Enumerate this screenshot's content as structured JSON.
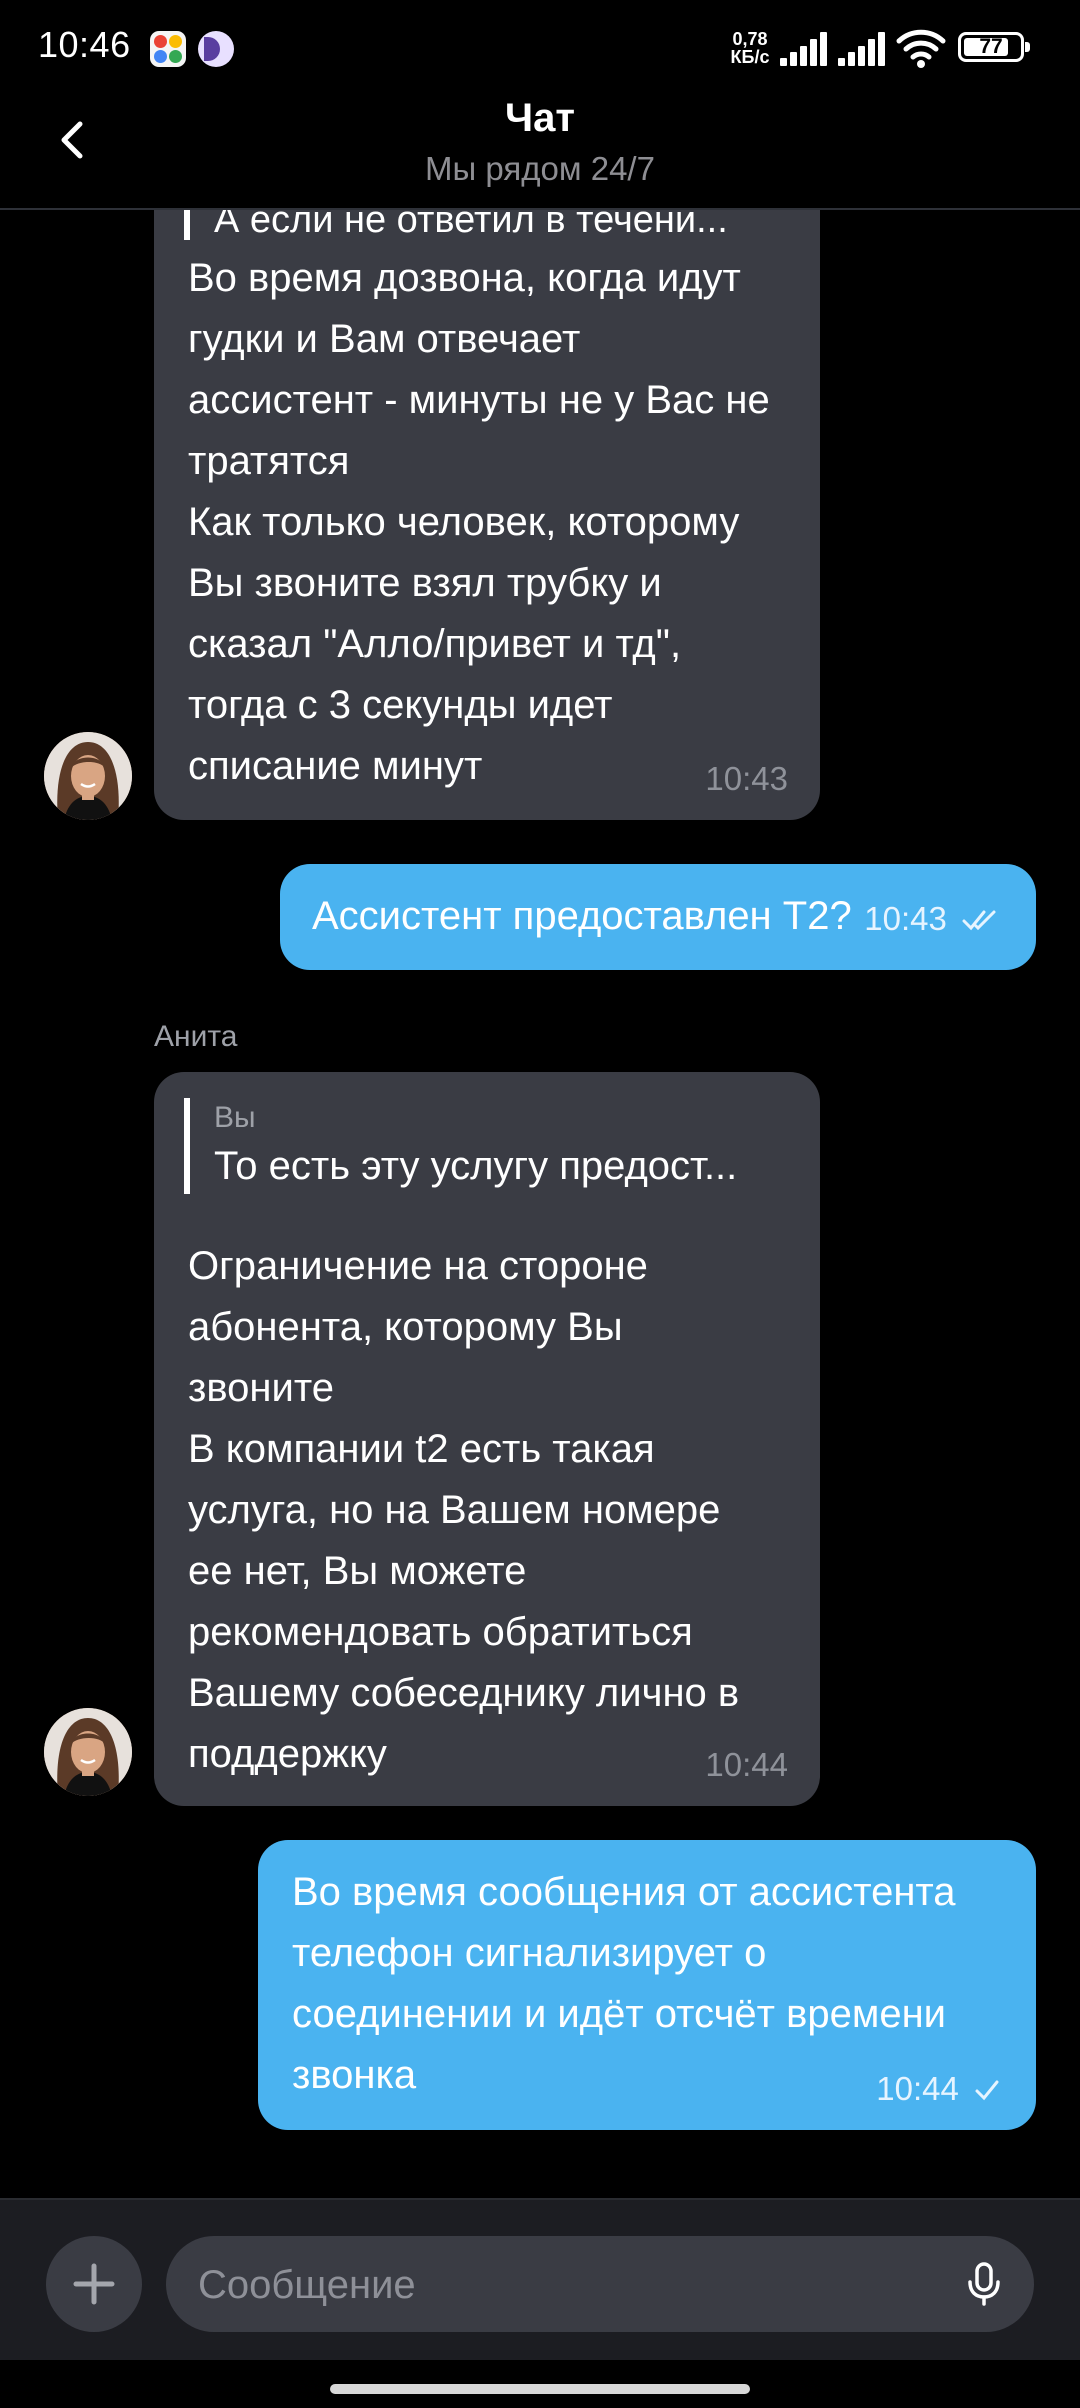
{
  "status_bar": {
    "time": "10:46",
    "net_speed_value": "0,78",
    "net_speed_unit": "КБ/с",
    "battery": "77",
    "icons": [
      "photos-app-icon",
      "moon-app-icon",
      "signal-icon",
      "signal-icon",
      "wifi-icon",
      "battery-icon"
    ]
  },
  "header": {
    "back_icon": "chevron-left-icon",
    "title": "Чат",
    "subtitle": "Мы рядом 24/7"
  },
  "messages": [
    {
      "direction": "incoming",
      "quote_text_partial": "А если не ответил в течени...",
      "text": "Во время дозвона, когда идут\nгудки и Вам отвечает\nассистент - минуты не у Вас не\nтратятся\nКак только человек, которому\nВы звоните взял трубку и\nсказал \"Алло/привет и тд\",\nтогда с 3 секунды идет\nсписание минут",
      "time": "10:43"
    },
    {
      "direction": "outgoing",
      "text": "Ассистент предоставлен Т2?",
      "time": "10:43",
      "status": "read"
    },
    {
      "direction": "incoming",
      "sender": "Анита",
      "quote_author": "Вы",
      "quote_text": "То есть эту услугу предост...",
      "text": "Ограничение на стороне\nабонента, которому Вы\nзвоните\nВ компании t2 есть такая\nуслуга, но на Вашем номере\nее нет, Вы можете\nрекомендовать обратиться\nВашему собеседнику лично в\nподдержку",
      "time": "10:44"
    },
    {
      "direction": "outgoing",
      "text": "Во время сообщения от ассистента\nтелефон сигнализирует о\nсоединении и идёт отсчёт времени\nзвонка",
      "time": "10:44",
      "status": "sent"
    }
  ],
  "composer": {
    "placeholder": "Сообщение",
    "attach_icon": "plus-icon",
    "mic_icon": "microphone-icon"
  },
  "colors": {
    "background": "#000000",
    "incoming_bubble": "#3a3c44",
    "outgoing_bubble": "#4ab3f0",
    "muted_text": "#8e8e93"
  }
}
